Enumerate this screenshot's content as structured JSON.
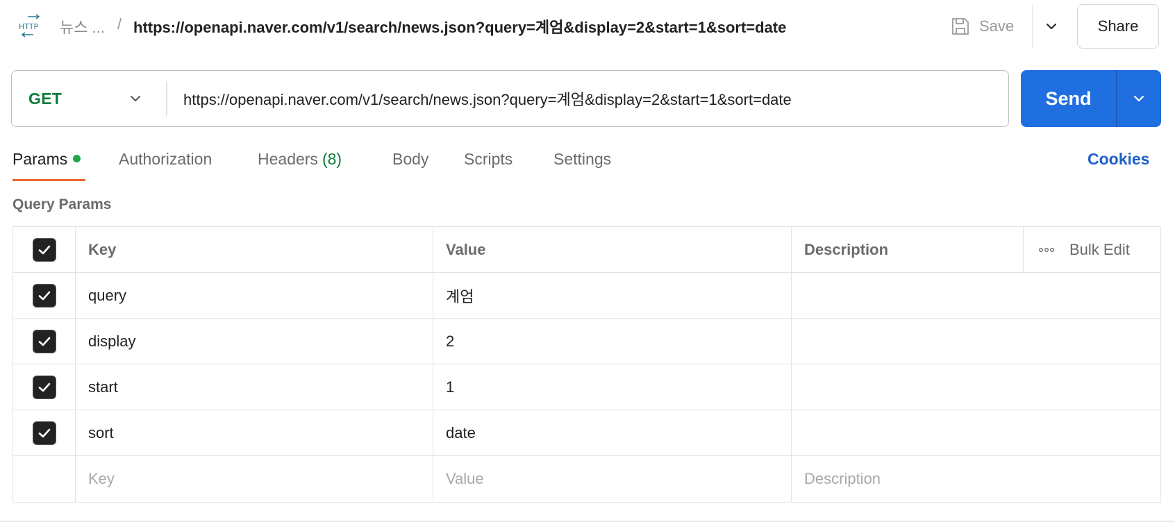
{
  "header": {
    "breadcrumb_parent": "뉴스 ...",
    "breadcrumb_separator": "/",
    "request_title": "https://openapi.naver.com/v1/search/news.json?query=계엄&display=2&start=1&sort=date",
    "save_label": "Save",
    "share_label": "Share",
    "http_icon_text": "HTTP"
  },
  "request": {
    "method": "GET",
    "url": "https://openapi.naver.com/v1/search/news.json?query=계엄&display=2&start=1&sort=date",
    "send_label": "Send"
  },
  "tabs": {
    "params": "Params",
    "authorization": "Authorization",
    "headers": "Headers",
    "headers_count": "(8)",
    "body": "Body",
    "scripts": "Scripts",
    "settings": "Settings",
    "cookies": "Cookies"
  },
  "query_params": {
    "title": "Query Params",
    "columns": {
      "key": "Key",
      "value": "Value",
      "description": "Description",
      "bulk_edit": "Bulk Edit"
    },
    "rows": [
      {
        "key": "query",
        "value": "계엄",
        "description": "",
        "checked": true
      },
      {
        "key": "display",
        "value": "2",
        "description": "",
        "checked": true
      },
      {
        "key": "start",
        "value": "1",
        "description": "",
        "checked": true
      },
      {
        "key": "sort",
        "value": "date",
        "description": "",
        "checked": true
      }
    ],
    "placeholders": {
      "key": "Key",
      "value": "Value",
      "description": "Description"
    }
  },
  "colors": {
    "method_get": "#0f7a3a",
    "send_button": "#1f6fe0",
    "active_tab_underline": "#e8692d",
    "params_dot": "#1fa64a",
    "cookies_link": "#1f5fcc"
  },
  "icons": [
    "http-icon",
    "save-icon",
    "chevron-down-icon",
    "check-icon",
    "more-horizontal-icon"
  ]
}
